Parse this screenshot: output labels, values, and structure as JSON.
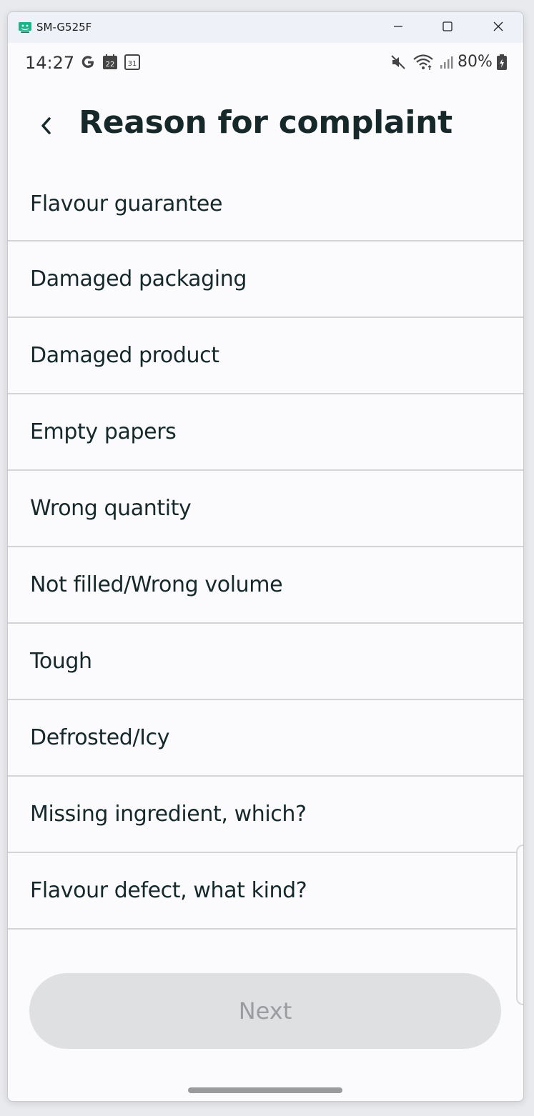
{
  "window": {
    "title": "SM-G525F",
    "minimize_icon": "minimize-icon",
    "maximize_icon": "maximize-icon",
    "close_icon": "close-icon"
  },
  "status_bar": {
    "time": "14:27",
    "notification_icons": [
      "google-icon",
      "calendar-22-icon",
      "calendar-31-icon"
    ],
    "right_icons": [
      "mute-icon",
      "wifi-icon",
      "signal-icon",
      "battery-icon"
    ],
    "battery": "80%"
  },
  "header": {
    "back_icon": "chevron-left-icon",
    "title": "Reason for complaint"
  },
  "reasons": [
    "Flavour guarantee",
    "Damaged packaging",
    "Damaged product",
    "Empty papers",
    "Wrong quantity",
    "Not filled/Wrong volume",
    "Tough",
    "Defrosted/Icy",
    "Missing ingredient, which?",
    "Flavour defect, what kind?"
  ],
  "footer": {
    "next_label": "Next"
  },
  "colors": {
    "background": "#fbfbfd",
    "text": "#15282b",
    "divider": "#d2d4d6",
    "button_disabled_bg": "#dfe0e2",
    "button_disabled_text": "#9a9c9f",
    "android_icon": "#1db38a"
  }
}
